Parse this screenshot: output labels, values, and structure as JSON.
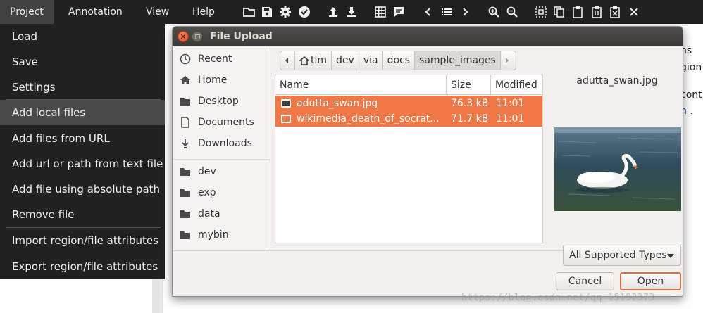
{
  "menubar": {
    "items": [
      "Project",
      "Annotation",
      "View",
      "Help"
    ]
  },
  "toolbar": {
    "icons": [
      "folder-open-icon",
      "save-icon",
      "gear-icon",
      "check-circle-icon",
      "upload-icon",
      "download-icon",
      "grid-icon",
      "comment-icon",
      "chevron-left-icon",
      "list-icon",
      "chevron-right-icon",
      "zoom-in-icon",
      "zoom-out-icon",
      "select-all-icon",
      "copy-icon",
      "paste-icon",
      "paste-special-icon",
      "delete-icon",
      "close-icon"
    ]
  },
  "background_page": {
    "snippets": [
      "ns",
      "gion",
      "conti",
      "n ."
    ]
  },
  "dropdown": {
    "items": [
      "Load",
      "Save",
      "Settings",
      "Add local files",
      "Add files from URL",
      "Add url or path from text file",
      "Add file using absolute path",
      "Remove file",
      "Import region/file attributes",
      "Export region/file attributes"
    ],
    "hovered": "Add local files"
  },
  "dialog": {
    "title": "File Upload",
    "places": [
      {
        "label": "Recent",
        "icon": "clock-icon"
      },
      {
        "label": "Home",
        "icon": "home-icon"
      },
      {
        "label": "Desktop",
        "icon": "folder-icon"
      },
      {
        "label": "Documents",
        "icon": "document-icon"
      },
      {
        "label": "Downloads",
        "icon": "download-icon"
      },
      {
        "label": "dev",
        "icon": "folder-icon"
      },
      {
        "label": "exp",
        "icon": "folder-icon"
      },
      {
        "label": "data",
        "icon": "folder-icon"
      },
      {
        "label": "mybin",
        "icon": "folder-icon"
      }
    ],
    "breadcrumb": [
      "tlm",
      "dev",
      "via",
      "docs",
      "sample_images"
    ],
    "breadcrumb_active": "sample_images",
    "columns": {
      "name": "Name",
      "size": "Size",
      "modified": "Modified"
    },
    "files": [
      {
        "name": "adutta_swan.jpg",
        "size": "76.3 kB",
        "modified": "11:01"
      },
      {
        "name": "wikimedia_death_of_socrat...",
        "size": "71.7 kB",
        "modified": "11:01"
      }
    ],
    "preview_name": "adutta_swan.jpg",
    "filter": "All Supported Types",
    "cancel_label": "Cancel",
    "open_label": "Open",
    "accent": "#f07746"
  },
  "watermark": "https://blog.csdn.net/qq_15192373"
}
